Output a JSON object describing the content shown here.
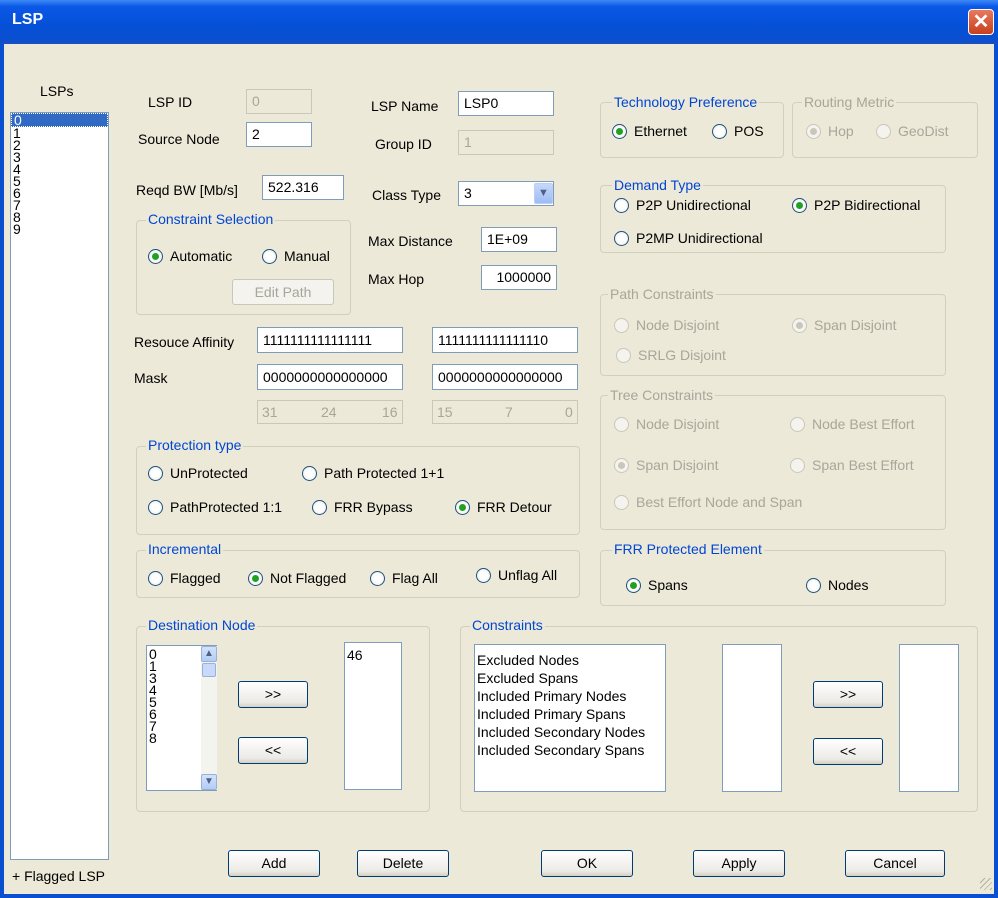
{
  "window": {
    "title": "LSP",
    "close_glyph": "✕"
  },
  "lsps": {
    "label": "LSPs",
    "items": [
      "0",
      "1",
      "2",
      "3",
      "4",
      "5",
      "6",
      "7",
      "8",
      "9"
    ],
    "footer": "+ Flagged LSP"
  },
  "fields": {
    "lsp_id_label": "LSP ID",
    "lsp_id_value": "0",
    "source_node_label": "Source Node",
    "source_node_value": "2",
    "lsp_name_label": "LSP Name",
    "lsp_name_value": "LSP0",
    "group_id_label": "Group ID",
    "group_id_value": "1",
    "reqd_bw_label": "Reqd BW [Mb/s]",
    "reqd_bw_value": "522.316",
    "class_type_label": "Class Type",
    "class_type_value": "3",
    "max_distance_label": "Max Distance",
    "max_distance_value": "1E+09",
    "max_hop_label": "Max Hop",
    "max_hop_value": "1000000"
  },
  "constraint_selection": {
    "legend": "Constraint Selection",
    "automatic": "Automatic",
    "manual": "Manual",
    "edit_path": "Edit Path"
  },
  "affinity": {
    "resource_label": "Resouce Affinity",
    "mask_label": "Mask",
    "resource_left": "1111111111111111",
    "resource_right": "1111111111111110",
    "mask_left": "0000000000000000",
    "mask_right": "0000000000000000",
    "bits_left": [
      "31",
      "24",
      "16"
    ],
    "bits_right": [
      "15",
      "7",
      "0"
    ]
  },
  "protection": {
    "legend": "Protection type",
    "unprotected": "UnProtected",
    "path_1p1": "Path Protected 1+1",
    "path_1to1": "PathProtected 1:1",
    "frr_bypass": "FRR Bypass",
    "frr_detour": "FRR Detour"
  },
  "incremental": {
    "legend": "Incremental",
    "flagged": "Flagged",
    "not_flagged": "Not Flagged",
    "flag_all": "Flag All",
    "unflag_all": "Unflag All"
  },
  "destination": {
    "legend": "Destination Node",
    "available": [
      "0",
      "1",
      "3",
      "4",
      "5",
      "6",
      "7",
      "8"
    ],
    "selected": [
      "46"
    ],
    "add": ">>",
    "remove": "<<"
  },
  "constraints": {
    "legend": "Constraints",
    "items": [
      "Excluded Nodes",
      "Excluded Spans",
      "Included Primary Nodes",
      "Included Primary Spans",
      "Included Secondary Nodes",
      "Included Secondary Spans"
    ],
    "add": ">>",
    "remove": "<<"
  },
  "technology": {
    "legend": "Technology Preference",
    "ethernet": "Ethernet",
    "pos": "POS"
  },
  "routing_metric": {
    "legend": "Routing Metric",
    "hop": "Hop",
    "geodist": "GeoDist"
  },
  "demand": {
    "legend": "Demand Type",
    "p2p_uni": "P2P Unidirectional",
    "p2p_bi": "P2P Bidirectional",
    "p2mp_uni": "P2MP Unidirectional"
  },
  "path_constraints": {
    "legend": "Path Constraints",
    "node_disjoint": "Node Disjoint",
    "span_disjoint": "Span Disjoint",
    "srlg_disjoint": "SRLG Disjoint"
  },
  "tree_constraints": {
    "legend": "Tree Constraints",
    "node_disjoint": "Node Disjoint",
    "node_best_effort": "Node Best Effort",
    "span_disjoint": "Span Disjoint",
    "span_best_effort": "Span Best Effort",
    "best_effort_node_span": "Best Effort Node and Span"
  },
  "frr_element": {
    "legend": "FRR Protected Element",
    "spans": "Spans",
    "nodes": "Nodes"
  },
  "buttons": {
    "add": "Add",
    "delete": "Delete",
    "ok": "OK",
    "apply": "Apply",
    "cancel": "Cancel"
  },
  "colors": {
    "title_bar": "#0a58e6",
    "dialog_bg": "#ece9d8",
    "legend_text": "#0046d5",
    "selection": "#316ac5",
    "radio_dot": "#21a121"
  }
}
